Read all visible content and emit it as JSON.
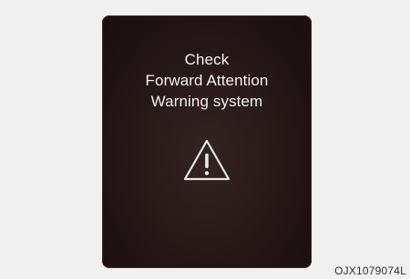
{
  "display": {
    "message_lines": [
      "Check",
      "Forward Attention",
      "Warning system"
    ],
    "icon": "warning-triangle-icon",
    "colors": {
      "panel_background": "#241616",
      "text": "#f2f2f2",
      "page_background": "#f0f0f0"
    }
  },
  "figure_code": "OJX1079074L"
}
